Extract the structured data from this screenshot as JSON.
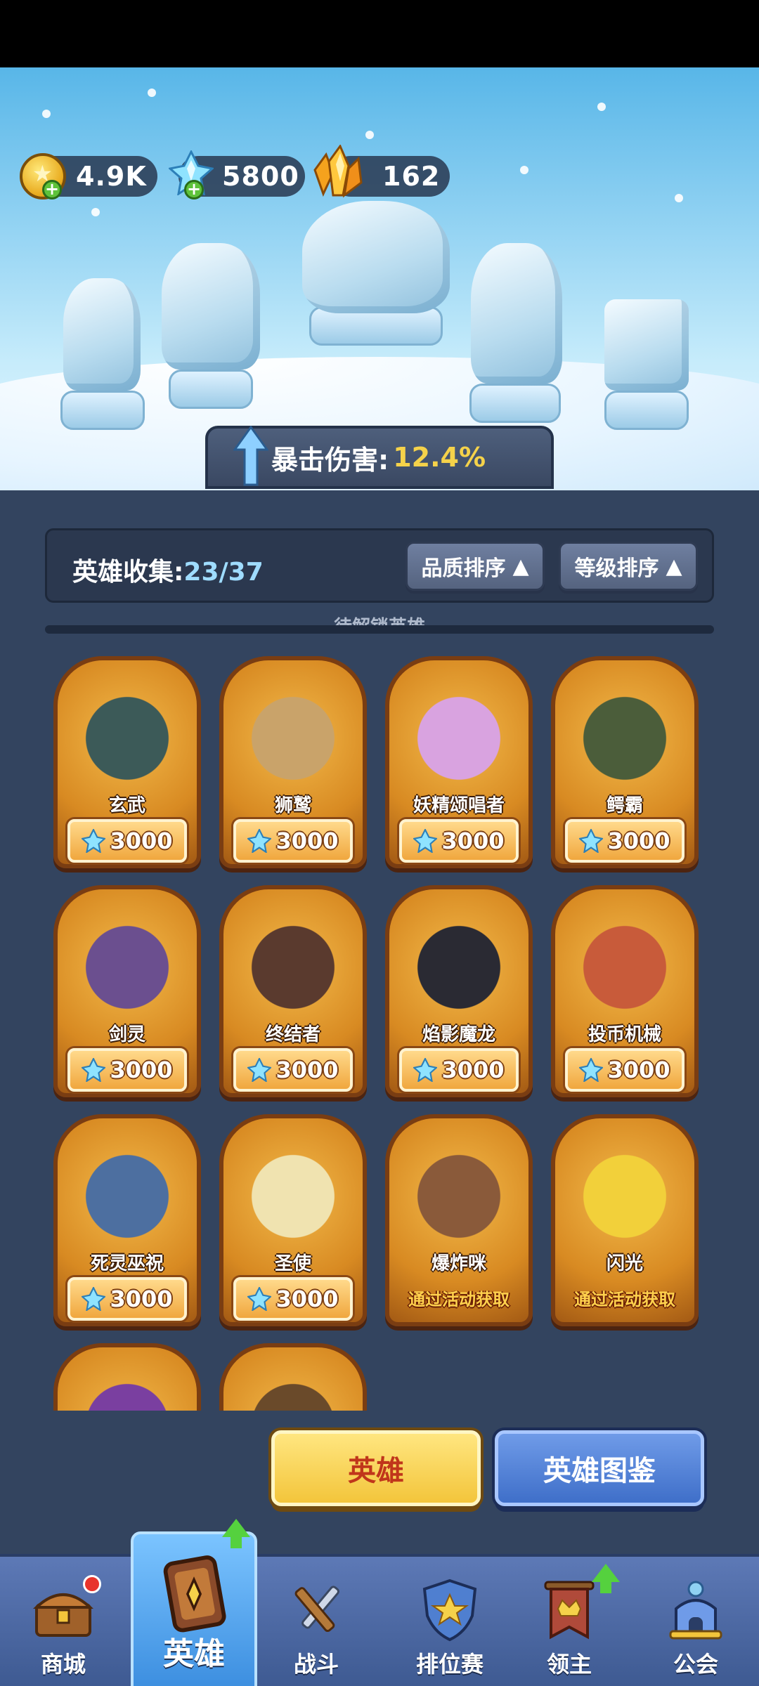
{
  "currencies": {
    "coins": "4.9K",
    "gems": "5800",
    "crystals": "162"
  },
  "crit": {
    "label": "暴击伤害:",
    "value": "12.4%"
  },
  "collection": {
    "label": "英雄收集:",
    "count": "23/37",
    "sort_quality": "品质排序",
    "sort_level": "等级排序",
    "section_title": "待解锁英雄"
  },
  "heroes": [
    {
      "name": "玄武",
      "price": "3000",
      "color": "#3c5a58"
    },
    {
      "name": "狮鹫",
      "price": "3000",
      "color": "#c9a36a"
    },
    {
      "name": "妖精颂唱者",
      "price": "3000",
      "color": "#d9a3e0"
    },
    {
      "name": "鳄霸",
      "price": "3000",
      "color": "#4b5d3a"
    },
    {
      "name": "剑灵",
      "price": "3000",
      "color": "#6b4f8f"
    },
    {
      "name": "终结者",
      "price": "3000",
      "color": "#5a3a2e"
    },
    {
      "name": "焰影魔龙",
      "price": "3000",
      "color": "#2a2a33"
    },
    {
      "name": "投币机械",
      "price": "3000",
      "color": "#c85b3a"
    },
    {
      "name": "死灵巫祝",
      "price": "3000",
      "color": "#4d6fa0"
    },
    {
      "name": "圣使",
      "price": "3000",
      "color": "#f0e3b0"
    },
    {
      "name": "爆炸咪",
      "event": "通过活动获取",
      "color": "#8a5a3a"
    },
    {
      "name": "闪光",
      "event": "通过活动获取",
      "color": "#f2d03a"
    }
  ],
  "actions": {
    "heroes": "英雄",
    "codex": "英雄图鉴"
  },
  "nav": {
    "shop": "商城",
    "heroes": "英雄",
    "battle": "战斗",
    "ranked": "排位赛",
    "lord": "领主",
    "guild": "公会"
  }
}
